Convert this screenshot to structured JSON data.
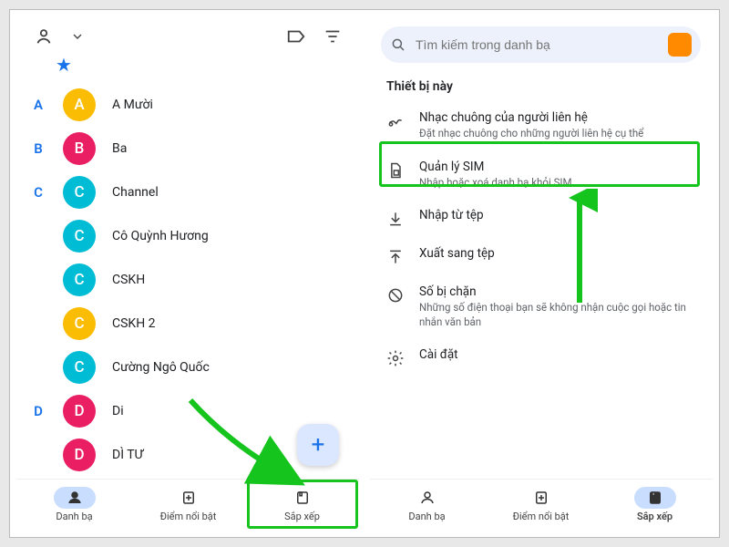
{
  "left": {
    "alpha": {
      "A": "A",
      "B": "B",
      "C": "C",
      "D": "D"
    },
    "contacts": [
      {
        "letter": "A",
        "initial": "A",
        "name": "A Mười",
        "color": "#fbbc04"
      },
      {
        "letter": "B",
        "initial": "B",
        "name": "Ba",
        "color": "#e91e63"
      },
      {
        "letter": "C",
        "initial": "C",
        "name": "Channel",
        "color": "#00bcd4"
      },
      {
        "letter": "",
        "initial": "C",
        "name": "Cô Quỳnh Hương",
        "color": "#00bcd4"
      },
      {
        "letter": "",
        "initial": "C",
        "name": "CSKH",
        "color": "#00bcd4"
      },
      {
        "letter": "",
        "initial": "C",
        "name": "CSKH 2",
        "color": "#fbbc04"
      },
      {
        "letter": "",
        "initial": "C",
        "name": "Cường Ngô Quốc",
        "color": "#00bcd4"
      },
      {
        "letter": "D",
        "initial": "D",
        "name": "Di",
        "color": "#e91e63"
      },
      {
        "letter": "",
        "initial": "D",
        "name": "DÌ TƯ",
        "color": "#e91e63"
      }
    ],
    "fab": "+",
    "nav": {
      "contacts": "Danh bạ",
      "highlights": "Điểm nổi bật",
      "organize": "Sắp xếp"
    }
  },
  "right": {
    "search_placeholder": "Tìm kiếm trong danh bạ",
    "section": "Thiết bị này",
    "items": {
      "ringtone_title": "Nhạc chuông của người liên hệ",
      "ringtone_sub": "Đặt nhạc chuông cho những người liên hệ cụ thể",
      "sim_title": "Quản lý SIM",
      "sim_sub": "Nhập hoặc xoá danh bạ khỏi SIM",
      "import_title": "Nhập từ tệp",
      "export_title": "Xuất sang tệp",
      "blocked_title": "Số bị chặn",
      "blocked_sub": "Những số điện thoại bạn sẽ không nhận cuộc gọi hoặc tin nhắn văn bản",
      "settings_title": "Cài đặt"
    },
    "nav": {
      "contacts": "Danh bạ",
      "highlights": "Điểm nổi bật",
      "organize": "Sắp xếp"
    }
  },
  "colors": {
    "highlight": "#17c41e",
    "arrow": "#16c41e"
  }
}
